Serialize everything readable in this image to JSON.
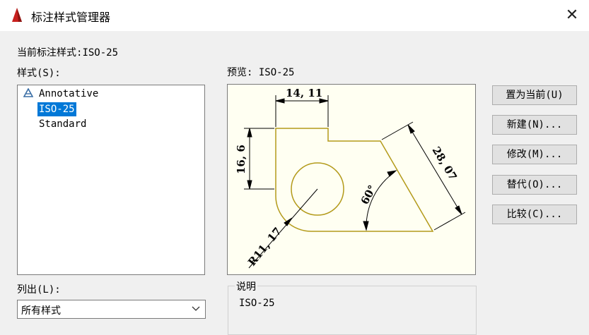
{
  "window": {
    "title": "标注样式管理器",
    "close_glyph": "✕"
  },
  "current_style": {
    "label": "当前标注样式:",
    "value": "ISO-25"
  },
  "styles": {
    "label": "样式(S):",
    "items": [
      {
        "label": "Annotative",
        "selected": false,
        "icon": "annotative-icon"
      },
      {
        "label": "ISO-25",
        "selected": true
      },
      {
        "label": "Standard",
        "selected": false
      }
    ]
  },
  "list_filter": {
    "label": "列出(L):",
    "value": "所有样式"
  },
  "preview": {
    "label": "预览: ISO-25",
    "dims": {
      "width": "14, 11",
      "height": "16, 6",
      "aligned": "28, 07",
      "angle": "60°",
      "radius": "R11, 17"
    }
  },
  "description": {
    "label": "说明",
    "text": "ISO-25"
  },
  "buttons": {
    "set_current": "置为当前(U)",
    "new": "新建(N)...",
    "modify": "修改(M)...",
    "override": "替代(O)...",
    "compare": "比较(C)..."
  },
  "colors": {
    "selection": "#0078d7",
    "geometry": "#b39a1a",
    "preview_bg": "#fffff2"
  }
}
